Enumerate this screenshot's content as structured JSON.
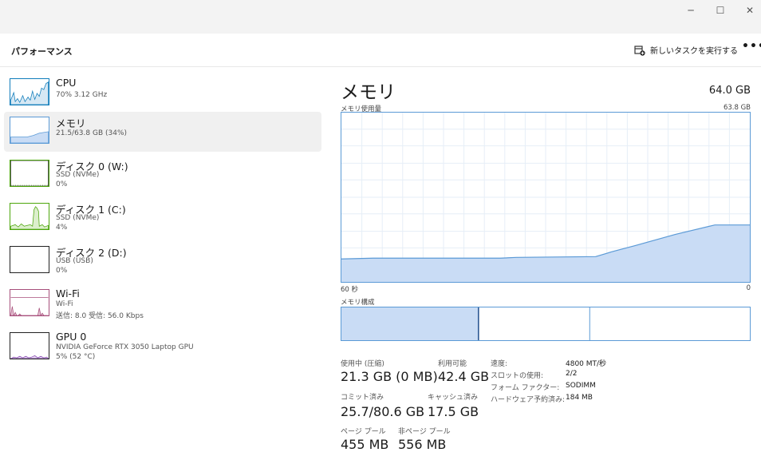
{
  "window": {
    "minimize": "─",
    "maximize": "☐",
    "close": "✕"
  },
  "header": {
    "title": "パフォーマンス",
    "new_task": "新しいタスクを実行する",
    "more": "•••"
  },
  "sidebar": [
    {
      "name": "CPU",
      "sub1": "70%  3.12 GHz",
      "sub2": "",
      "sub3": ""
    },
    {
      "name": "メモリ",
      "sub1": "21.5/63.8 GB (34%)",
      "sub2": "",
      "sub3": ""
    },
    {
      "name": "ディスク 0 (W:)",
      "sub1": "SSD (NVMe)",
      "sub2": "0%",
      "sub3": ""
    },
    {
      "name": "ディスク 1 (C:)",
      "sub1": "SSD (NVMe)",
      "sub2": "4%",
      "sub3": ""
    },
    {
      "name": "ディスク 2 (D:)",
      "sub1": "USB (USB)",
      "sub2": "0%",
      "sub3": ""
    },
    {
      "name": "Wi-Fi",
      "sub1": "Wi-Fi",
      "sub2": "送信: 8.0  受信: 56.0 Kbps",
      "sub3": ""
    },
    {
      "name": "GPU 0",
      "sub1": "NVIDIA GeForce RTX 3050 Laptop GPU",
      "sub2": "5%  (52 °C)",
      "sub3": ""
    }
  ],
  "main": {
    "title": "メモリ",
    "total": "64.0 GB",
    "usage_label": "メモリ使用量",
    "usage_max": "63.8 GB",
    "time_left": "60 秒",
    "time_right": "0",
    "composition_label": "メモリ構成",
    "stats": {
      "in_use_label": "使用中 (圧縮)",
      "in_use_value": "21.3 GB (0 MB)",
      "available_label": "利用可能",
      "available_value": "42.4 GB",
      "committed_label": "コミット済み",
      "committed_value": "25.7/80.6 GB",
      "cached_label": "キャッシュ済み",
      "cached_value": "17.5 GB",
      "paged_label": "ページ プール",
      "paged_value": "455 MB",
      "nonpaged_label": "非ページ プール",
      "nonpaged_value": "556 MB"
    },
    "details": {
      "speed_label": "速度:",
      "speed_value": "4800 MT/秒",
      "slots_label": "スロットの使用:",
      "slots_value": "2/2",
      "form_label": "フォーム ファクター:",
      "form_value": "SODIMM",
      "reserved_label": "ハードウェア予約済み:",
      "reserved_value": "184 MB"
    }
  },
  "colors": {
    "cpu": "#117dbb",
    "memory": "#5b9ad6",
    "memory_fill": "#c9dcf5",
    "disk": "#4da60c",
    "wifi": "#a74f7b",
    "gpu": "#7c3aa8"
  }
}
